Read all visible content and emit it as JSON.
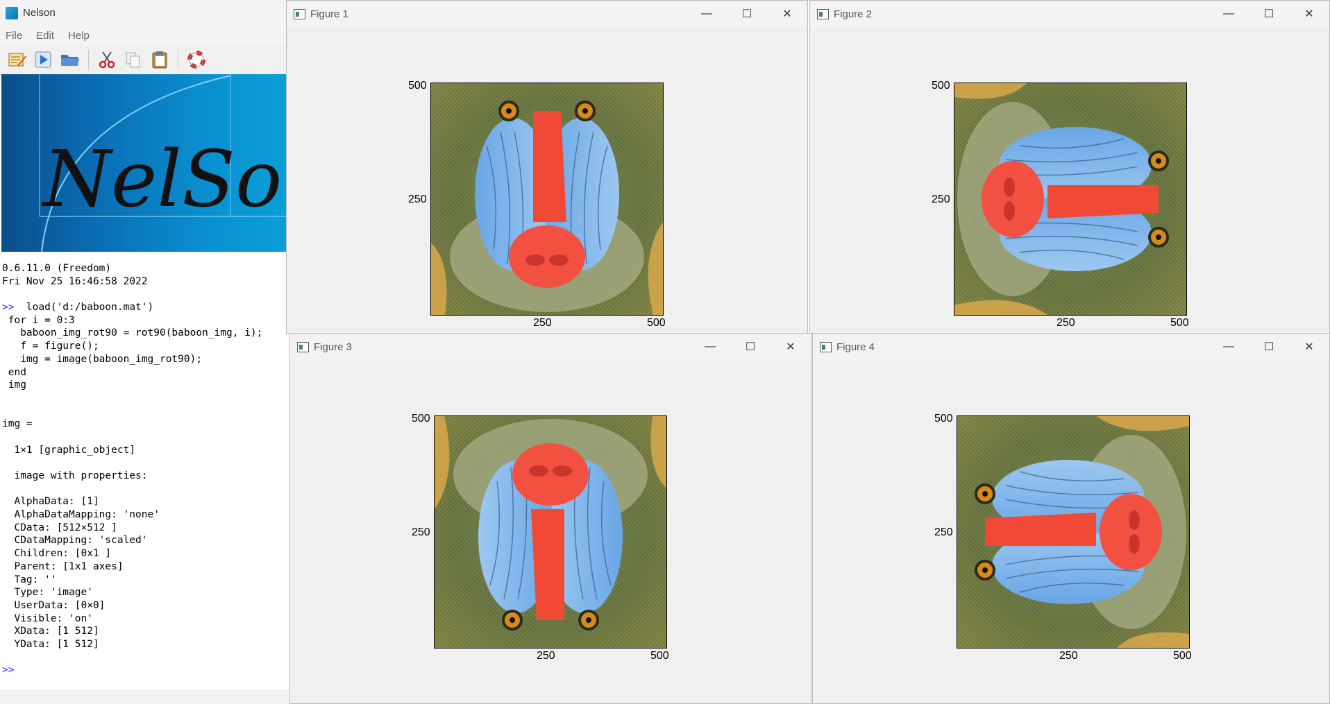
{
  "app": {
    "title": "Nelson",
    "menu": [
      "File",
      "Edit",
      "Help"
    ],
    "toolbar_icons": [
      "new-editor-icon",
      "run-icon",
      "open-folder-icon",
      "cut-icon",
      "copy-icon",
      "paste-icon",
      "help-lifebuoy-icon"
    ],
    "banner_text": "NelSon"
  },
  "console": {
    "lines": [
      {
        "text": "0.6.11.0 (Freedom)"
      },
      {
        "text": "Fri Nov 25 16:46:58 2022"
      },
      {
        "text": ""
      },
      {
        "prompt": ">>",
        "text": "  load('d:/baboon.mat')"
      },
      {
        "text": " for i = 0:3"
      },
      {
        "text": "   baboon_img_rot90 = rot90(baboon_img, i);"
      },
      {
        "text": "   f = figure();"
      },
      {
        "text": "   img = image(baboon_img_rot90);"
      },
      {
        "text": " end"
      },
      {
        "text": " img"
      },
      {
        "text": ""
      },
      {
        "text": ""
      },
      {
        "text": "img ="
      },
      {
        "text": ""
      },
      {
        "text": "  1×1 [graphic_object]"
      },
      {
        "text": ""
      },
      {
        "text": "  image with properties:"
      },
      {
        "text": ""
      },
      {
        "text": "  AlphaData: [1]"
      },
      {
        "text": "  AlphaDataMapping: 'none'"
      },
      {
        "text": "  CData: [512×512 ]"
      },
      {
        "text": "  CDataMapping: 'scaled'"
      },
      {
        "text": "  Children: [0x1 ]"
      },
      {
        "text": "  Parent: [1x1 axes]"
      },
      {
        "text": "  Tag: ''"
      },
      {
        "text": "  Type: 'image'"
      },
      {
        "text": "  UserData: [0×0]"
      },
      {
        "text": "  Visible: 'on'"
      },
      {
        "text": "  XData: [1 512]"
      },
      {
        "text": "  YData: [1 512]"
      },
      {
        "text": ""
      },
      {
        "prompt": ">>",
        "text": ""
      }
    ]
  },
  "figures": [
    {
      "title": "Figure 1",
      "rotation_deg": 0,
      "yticks": [
        "500",
        "250"
      ],
      "xticks": [
        "250",
        "500"
      ]
    },
    {
      "title": "Figure 2",
      "rotation_deg": 90,
      "yticks": [
        "500",
        "250"
      ],
      "xticks": [
        "250",
        "500"
      ]
    },
    {
      "title": "Figure 3",
      "rotation_deg": 180,
      "yticks": [
        "500",
        "250"
      ],
      "xticks": [
        "250",
        "500"
      ]
    },
    {
      "title": "Figure 4",
      "rotation_deg": 270,
      "yticks": [
        "500",
        "250"
      ],
      "xticks": [
        "250",
        "500"
      ]
    }
  ],
  "window_controls": {
    "minimize": "—",
    "maximize": "☐",
    "close": "✕"
  }
}
